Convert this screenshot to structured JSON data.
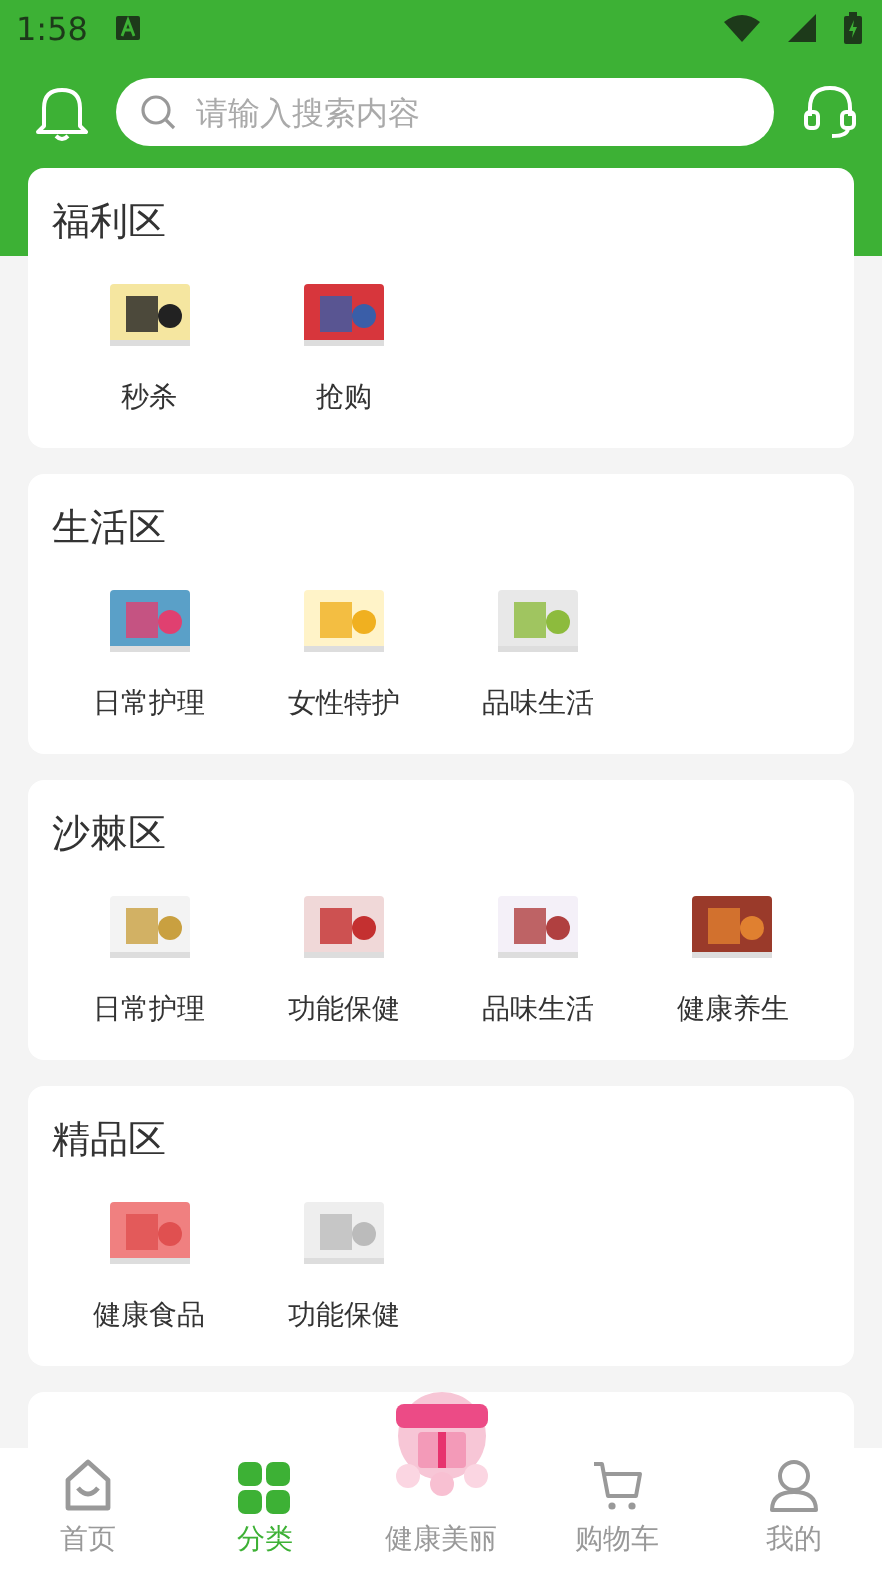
{
  "status_bar": {
    "time": "1:58"
  },
  "search": {
    "placeholder": "请输入搜索内容"
  },
  "sections": [
    {
      "title": "福利区",
      "items": [
        {
          "label": "秒杀"
        },
        {
          "label": "抢购"
        }
      ]
    },
    {
      "title": "生活区",
      "items": [
        {
          "label": "日常护理"
        },
        {
          "label": "女性特护"
        },
        {
          "label": "品味生活"
        }
      ]
    },
    {
      "title": "沙棘区",
      "items": [
        {
          "label": "日常护理"
        },
        {
          "label": "功能保健"
        },
        {
          "label": "品味生活"
        },
        {
          "label": "健康养生"
        }
      ]
    },
    {
      "title": "精品区",
      "items": [
        {
          "label": "健康食品"
        },
        {
          "label": "功能保健"
        }
      ]
    }
  ],
  "tab_bar": [
    {
      "label": "首页",
      "kind": "home",
      "selected": false
    },
    {
      "label": "分类",
      "kind": "grid",
      "selected": true
    },
    {
      "label": "健康美丽",
      "kind": "promo",
      "selected": false
    },
    {
      "label": "购物车",
      "kind": "cart",
      "selected": false
    },
    {
      "label": "我的",
      "kind": "user",
      "selected": false
    }
  ]
}
